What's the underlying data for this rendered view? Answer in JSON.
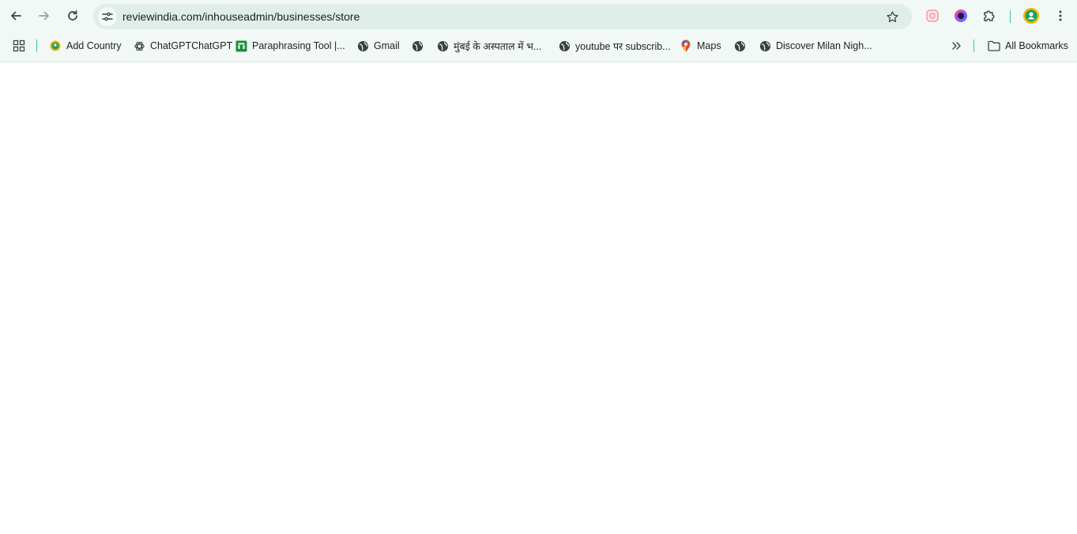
{
  "toolbar": {
    "url": "reviewindia.com/inhouseadmin/businesses/store",
    "back_icon": "arrow-left-icon",
    "forward_icon": "arrow-right-icon",
    "reload_icon": "reload-icon",
    "site_info_icon": "tune-icon",
    "bookmark_star_icon": "star-icon",
    "extensions": [
      "screen-capture-extension-icon",
      "color-picker-extension-icon",
      "puzzle-icon"
    ],
    "profile_icon": "profile-avatar-icon",
    "menu_icon": "three-dots-icon"
  },
  "bookmarks": {
    "apps_icon": "apps-grid-icon",
    "items": [
      {
        "label": "Add Country",
        "icon": "green-circle-favicon"
      },
      {
        "label": "ChatGPTChatGPT",
        "icon": "openai-icon"
      },
      {
        "label": "Paraphrasing Tool |...",
        "icon": "green-square-favicon"
      },
      {
        "label": "Gmail",
        "icon": "globe-icon"
      },
      {
        "label": "",
        "icon": "globe-icon"
      },
      {
        "label": "मुंबई के अस्पताल में भ...",
        "icon": "globe-icon"
      },
      {
        "label": "youtube पर subscrib...",
        "icon": "globe-icon"
      },
      {
        "label": "Maps",
        "icon": "maps-pin-icon"
      },
      {
        "label": "",
        "icon": "globe-icon"
      },
      {
        "label": "Discover Milan Nigh...",
        "icon": "globe-icon"
      }
    ],
    "overflow_icon": "chevron-double-right-icon",
    "all_bookmarks_label": "All Bookmarks",
    "all_bookmarks_icon": "folder-icon"
  },
  "colors": {
    "chrome_bg": "#f1f8f6",
    "omnibox_bg": "#dfeee9",
    "separator": "#2ec4b6",
    "page_bg": "#ffffff"
  }
}
